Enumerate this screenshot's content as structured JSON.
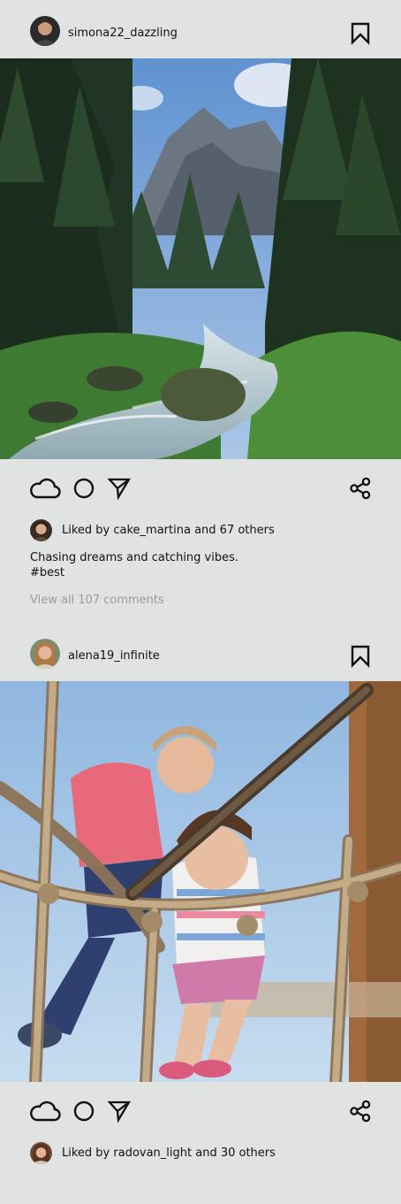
{
  "posts": [
    {
      "username": "simona22_dazzling",
      "image_subject": "mountain stream flowing through a green pine forest",
      "liked_by_user": "cake_martina",
      "liked_others": "67 others",
      "liked_text": "Liked by cake_martina and 67 others",
      "caption_line1": "Chasing dreams and catching vibes.",
      "caption_line2": "#best",
      "view_comments": "View all 107 comments"
    },
    {
      "username": "alena19_infinite",
      "image_subject": "two girls climbing a rope net at a playground",
      "liked_by_user": "radovan_light",
      "liked_others": "30 others",
      "liked_text": "Liked by radovan_light and 30 others"
    }
  ],
  "icons": {
    "like": "cloud-icon",
    "comment": "circle-icon",
    "share_direct": "send-icon",
    "share": "share-icon",
    "save": "bookmark-icon"
  },
  "colors": {
    "background": "#e1e3e2",
    "text": "#111111",
    "muted_text": "#9a9b9b"
  }
}
